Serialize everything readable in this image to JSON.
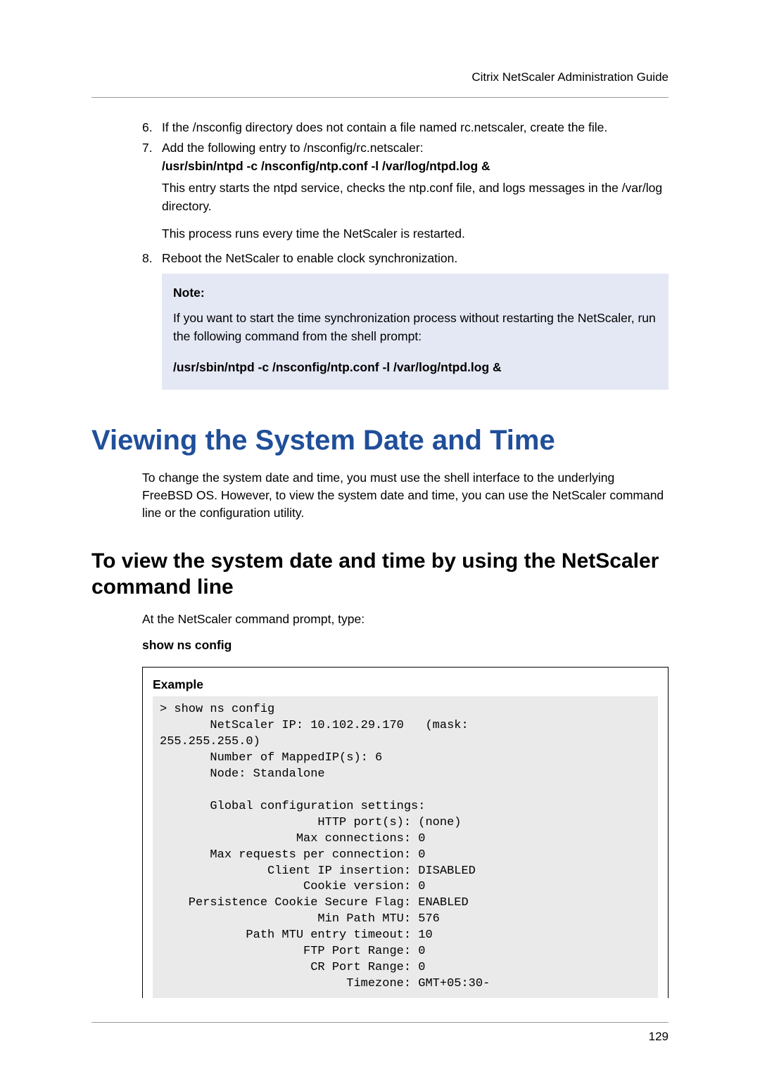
{
  "header": {
    "doc_title": "Citrix NetScaler Administration Guide"
  },
  "steps": {
    "s6": {
      "num": "6.",
      "text": "If the /nsconfig directory does not contain a file named rc.netscaler, create the file."
    },
    "s7": {
      "num": "7.",
      "line1": "Add the following entry to /nsconfig/rc.netscaler:",
      "cmd": "/usr/sbin/ntpd -c /nsconfig/ntp.conf -l /var/log/ntpd.log &",
      "line2": "This entry starts the ntpd service, checks the ntp.conf file, and logs messages in the /var/log directory.",
      "line3": "This process runs every time the NetScaler is restarted."
    },
    "s8": {
      "num": "8.",
      "text": "Reboot the NetScaler to enable clock synchronization."
    }
  },
  "note": {
    "label": "Note:",
    "body": "If you want to start the time synchronization process without restarting the NetScaler, run the following command from the shell prompt:",
    "cmd": "/usr/sbin/ntpd -c /nsconfig/ntp.conf -l /var/log/ntpd.log &"
  },
  "section": {
    "h1": "Viewing the System Date and Time",
    "intro": "To change the system date and time, you must use the shell interface to the underlying FreeBSD OS. However, to view the system date and time, you can use the NetScaler command line or the configuration utility.",
    "h2": "To view the system date and time by using the NetScaler command line",
    "p1": "At the NetScaler command prompt, type:",
    "cmd": "show ns config"
  },
  "example": {
    "label": "Example",
    "code": "> show ns config\n       NetScaler IP: 10.102.29.170   (mask:\n255.255.255.0)\n       Number of MappedIP(s): 6\n       Node: Standalone\n\n       Global configuration settings:\n                      HTTP port(s): (none)\n                   Max connections: 0\n       Max requests per connection: 0\n               Client IP insertion: DISABLED\n                    Cookie version: 0\n    Persistence Cookie Secure Flag: ENABLED\n                      Min Path MTU: 576\n            Path MTU entry timeout: 10\n                    FTP Port Range: 0\n                     CR Port Range: 0\n                          Timezone: GMT+05:30-"
  },
  "footer": {
    "page_num": "129"
  }
}
